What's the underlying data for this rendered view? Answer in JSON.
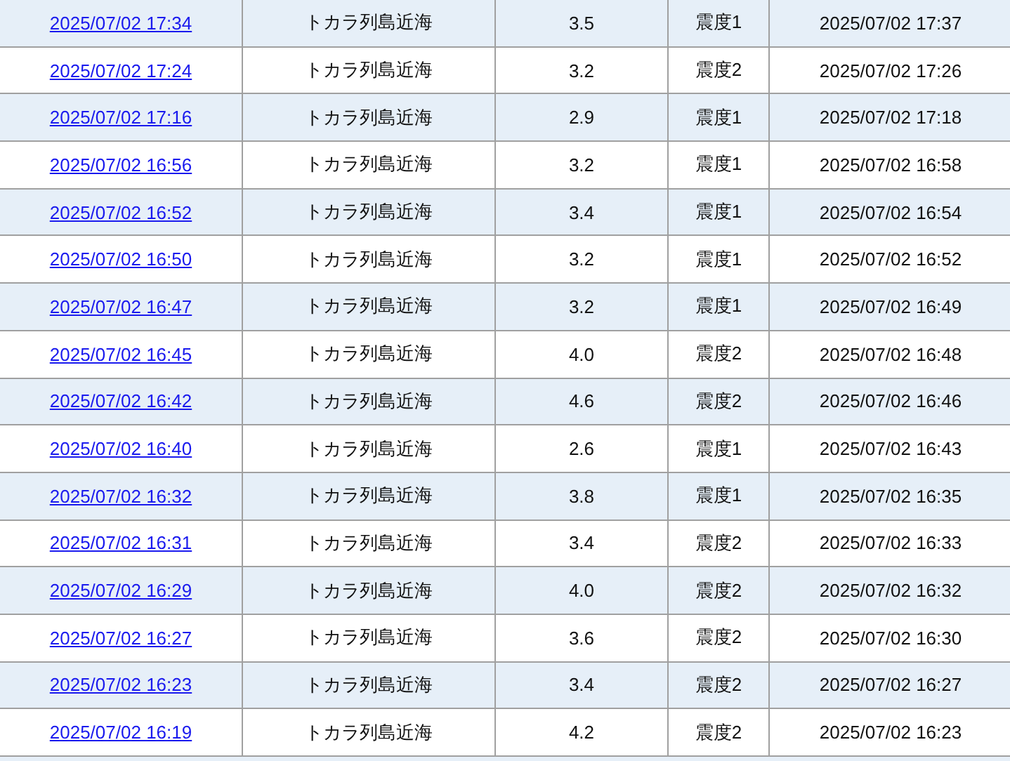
{
  "table": {
    "rows": [
      {
        "column_1": "2025/07/02 17:34",
        "column_2": "トカラ列島近海",
        "column_3": "3.5",
        "column_4": "震度1",
        "column_5": "2025/07/02 17:37"
      },
      {
        "column_1": "2025/07/02 17:24",
        "column_2": "トカラ列島近海",
        "column_3": "3.2",
        "column_4": "震度2",
        "column_5": "2025/07/02 17:26"
      },
      {
        "column_1": "2025/07/02 17:16",
        "column_2": "トカラ列島近海",
        "column_3": "2.9",
        "column_4": "震度1",
        "column_5": "2025/07/02 17:18"
      },
      {
        "column_1": "2025/07/02 16:56",
        "column_2": "トカラ列島近海",
        "column_3": "3.2",
        "column_4": "震度1",
        "column_5": "2025/07/02 16:58"
      },
      {
        "column_1": "2025/07/02 16:52",
        "column_2": "トカラ列島近海",
        "column_3": "3.4",
        "column_4": "震度1",
        "column_5": "2025/07/02 16:54"
      },
      {
        "column_1": "2025/07/02 16:50",
        "column_2": "トカラ列島近海",
        "column_3": "3.2",
        "column_4": "震度1",
        "column_5": "2025/07/02 16:52"
      },
      {
        "column_1": "2025/07/02 16:47",
        "column_2": "トカラ列島近海",
        "column_3": "3.2",
        "column_4": "震度1",
        "column_5": "2025/07/02 16:49"
      },
      {
        "column_1": "2025/07/02 16:45",
        "column_2": "トカラ列島近海",
        "column_3": "4.0",
        "column_4": "震度2",
        "column_5": "2025/07/02 16:48"
      },
      {
        "column_1": "2025/07/02 16:42",
        "column_2": "トカラ列島近海",
        "column_3": "4.6",
        "column_4": "震度2",
        "column_5": "2025/07/02 16:46"
      },
      {
        "column_1": "2025/07/02 16:40",
        "column_2": "トカラ列島近海",
        "column_3": "2.6",
        "column_4": "震度1",
        "column_5": "2025/07/02 16:43"
      },
      {
        "column_1": "2025/07/02 16:32",
        "column_2": "トカラ列島近海",
        "column_3": "3.8",
        "column_4": "震度1",
        "column_5": "2025/07/02 16:35"
      },
      {
        "column_1": "2025/07/02 16:31",
        "column_2": "トカラ列島近海",
        "column_3": "3.4",
        "column_4": "震度2",
        "column_5": "2025/07/02 16:33"
      },
      {
        "column_1": "2025/07/02 16:29",
        "column_2": "トカラ列島近海",
        "column_3": "4.0",
        "column_4": "震度2",
        "column_5": "2025/07/02 16:32"
      },
      {
        "column_1": "2025/07/02 16:27",
        "column_2": "トカラ列島近海",
        "column_3": "3.6",
        "column_4": "震度2",
        "column_5": "2025/07/02 16:30"
      },
      {
        "column_1": "2025/07/02 16:23",
        "column_2": "トカラ列島近海",
        "column_3": "3.4",
        "column_4": "震度2",
        "column_5": "2025/07/02 16:27"
      },
      {
        "column_1": "2025/07/02 16:19",
        "column_2": "トカラ列島近海",
        "column_3": "4.2",
        "column_4": "震度2",
        "column_5": "2025/07/02 16:23"
      }
    ]
  }
}
